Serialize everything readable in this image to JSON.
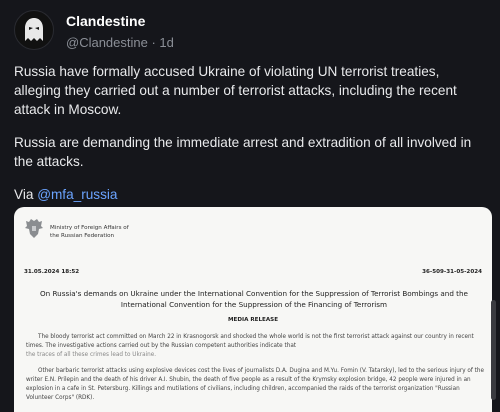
{
  "post": {
    "author_name": "Clandestine",
    "handle_time": "@Clandestine · 1d",
    "paragraph1": "Russia have formally accused Ukraine of violating UN terrorist treaties, alleging they carried out a number of terrorist attacks, including the recent attack in Moscow.",
    "paragraph2": "Russia are demanding the immediate arrest and extradition of all involved in the attacks.",
    "via_prefix": "Via ",
    "via_link": "@mfa_russia"
  },
  "document": {
    "ministry_line1": "Ministry of Foreign Affairs of",
    "ministry_line2": "the Russian Federation",
    "date": "31.05.2024 18:52",
    "ref": "36-509-31-05-2024",
    "title": "On Russia's demands on Ukraine under the International Convention for the Suppression of Terrorist Bombings and the International Convention for the Suppression of the Financing of Terrorism",
    "section": "MEDIA RELEASE",
    "para1": "The bloody terrorist act committed on March 22 in Krasnogorsk and shocked the whole world is not the first terrorist attack against our country in recent times. The investigative actions carried out by the Russian competent authorities indicate that",
    "para1_faint": "the traces of all these crimes lead to Ukraine.",
    "para2": "Other barbaric terrorist attacks using explosive devices cost the lives of journalists D.A. Dugina and M.Yu. Fomin (V. Tatarsky), led to the serious injury of the writer E.N. Prilepin and the death of his driver A.I. Shubin, the death of five people as a result of the Krymsky explosion bridge, 42 people were injured in an explosion in a cafe in St. Petersburg. Killings and mutilations of civilians, including children, accompanied the raids of the terrorist organization \"Russian Volunteer Corps\" (RDK)."
  },
  "colors": {
    "background": "#15161b",
    "link": "#6ba4ff",
    "document_bg": "#f7f7f5"
  }
}
